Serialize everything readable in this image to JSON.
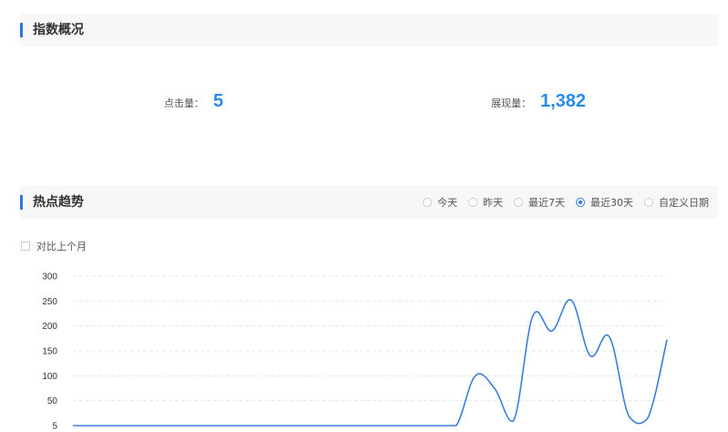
{
  "overview": {
    "title": "指数概况",
    "clicks_label": "点击量：",
    "clicks_value": "5",
    "impressions_label": "展现量：",
    "impressions_value": "1,382"
  },
  "trend": {
    "title": "热点趋势",
    "ranges": [
      {
        "label": "今天",
        "selected": false
      },
      {
        "label": "昨天",
        "selected": false
      },
      {
        "label": "最近7天",
        "selected": false
      },
      {
        "label": "最近30天",
        "selected": true
      },
      {
        "label": "自定义日期",
        "selected": false
      }
    ],
    "compare_label": "对比上个月"
  },
  "colors": {
    "accent": "#2a7ae2",
    "value": "#2a8ae8",
    "line": "#3b7ddd"
  },
  "chart_data": {
    "type": "line",
    "y_ticks": [
      "300",
      "250",
      "200",
      "150",
      "100",
      "50",
      "5"
    ],
    "ylim": [
      0,
      300
    ],
    "grid": true,
    "series": [
      {
        "values": [
          0,
          0,
          0,
          0,
          0,
          0,
          0,
          0,
          0,
          0,
          0,
          0,
          0,
          0,
          0,
          0,
          0,
          0,
          0,
          0,
          0,
          100,
          75,
          10,
          220,
          190,
          252,
          140,
          178,
          20,
          15,
          172
        ]
      }
    ]
  }
}
